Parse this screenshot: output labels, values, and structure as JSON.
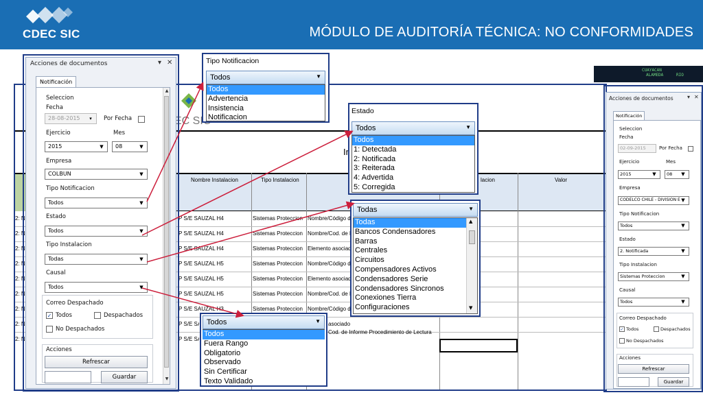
{
  "header": {
    "logo_text": "CDEC SIC",
    "title": "MÓDULO DE AUDITORÍA TÉCNICA: NO CONFORMIDADES"
  },
  "sheet": {
    "logo_fragment": "EC SIC",
    "title_fragment": "Inf",
    "col_headers": [
      "Nombre Instalacion",
      "Tipo Instalacion",
      "lacion",
      "Valor"
    ],
    "rows": [
      {
        "prefix": "2: N",
        "nombre": "P S/E SAUZAL H4",
        "tipo": "Sistemas Proteccion",
        "desc": "Nombre/Código de"
      },
      {
        "prefix": "2: N",
        "nombre": "P S/E SAUZAL H4",
        "tipo": "Sistemas Proteccion",
        "desc": "Nombre/Cod. de In"
      },
      {
        "prefix": "2: N",
        "nombre": "P S/E SAUZAL H4",
        "tipo": "Sistemas Proteccion",
        "desc": "Elemento asociado"
      },
      {
        "prefix": "2: N",
        "nombre": "P S/E SAUZAL H5",
        "tipo": "Sistemas Proteccion",
        "desc": "Nombre/Código de"
      },
      {
        "prefix": "2: N",
        "nombre": "P S/E SAUZAL H5",
        "tipo": "Sistemas Proteccion",
        "desc": "Elemento asociado"
      },
      {
        "prefix": "2: N",
        "nombre": "P S/E SAUZAL H5",
        "tipo": "Sistemas Proteccion",
        "desc": "Nombre/Cod. de In"
      },
      {
        "prefix": "2: N",
        "nombre": "P S/E SAUZAL H3",
        "tipo": "Sistemas Proteccion",
        "desc": "Nombre/Código de"
      },
      {
        "prefix": "2: N",
        "nombre": "P S/E SAUZAL H",
        "tipo": "",
        "desc": "asociado"
      },
      {
        "prefix": "2: N",
        "nombre": "P S/E SAUZAL H",
        "tipo": "",
        "desc": "Cod. de Informe Procedimiento de Lectura"
      }
    ]
  },
  "photo_strip": [
    "CUAYACAN",
    "ALAMEDA",
    "RIO"
  ],
  "panel_left": {
    "title": "Acciones de documentos",
    "tab": "Notificación",
    "seleccion": "Seleccion",
    "fecha_label": "Fecha",
    "fecha_value": "28-08-2015",
    "por_fecha": "Por Fecha",
    "ejercicio_label": "Ejercicio",
    "ejercicio_value": "2015",
    "mes_label": "Mes",
    "mes_value": "08",
    "empresa_label": "Empresa",
    "empresa_value": "COLBUN",
    "tipo_notif_label": "Tipo Notificacion",
    "tipo_notif_value": "Todos",
    "estado_label": "Estado",
    "estado_value": "Todos",
    "tipo_inst_label": "Tipo Instalacion",
    "tipo_inst_value": "Todas",
    "causal_label": "Causal",
    "causal_value": "Todos",
    "correo_label": "Correo Despachado",
    "todos": "Todos",
    "despachados": "Despachados",
    "no_despachados": "No Despachados",
    "acciones_label": "Acciones",
    "refrescar": "Refrescar",
    "guardar": "Guardar"
  },
  "panel_right": {
    "title": "Acciones de documentos",
    "tab": "Notificación",
    "seleccion": "Seleccion",
    "fecha_label": "Fecha",
    "fecha_value": "02-09-2015",
    "por_fecha": "Por Fecha",
    "ejercicio_label": "Ejercicio",
    "ejercicio_value": "2015",
    "mes_label": "Mes",
    "mes_value": "08",
    "empresa_label": "Empresa",
    "empresa_value": "CODELCO CHILE - DIVISION E",
    "tipo_notif_label": "Tipo Notificacion",
    "tipo_notif_value": "Todos",
    "estado_label": "Estado",
    "estado_value": "2. Notificada",
    "tipo_inst_label": "Tipo Instalacion",
    "tipo_inst_value": "Sistemas Proteccion",
    "causal_label": "Causal",
    "causal_value": "Todos",
    "correo_label": "Correo Despachado",
    "todos": "Todos",
    "despachados": "Despachados",
    "no_despachados": "No Despachados",
    "acciones_label": "Acciones",
    "refrescar": "Refrescar",
    "guardar": "Guardar"
  },
  "popup_tipo_notif": {
    "label": "Tipo Notificacion",
    "value": "Todos",
    "options": [
      "Todos",
      "Advertencia",
      "Insistencia",
      "Notificacion"
    ]
  },
  "popup_estado": {
    "label": "Estado",
    "value": "Todos",
    "options": [
      "Todos",
      "1: Detectada",
      "2: Notificada",
      "3: Reiterada",
      "4: Advertida",
      "5: Corregida"
    ]
  },
  "popup_tipo_inst": {
    "value": "Todas",
    "options": [
      "Todas",
      "Bancos Condensadores",
      "Barras",
      "Centrales",
      "Circuitos",
      "Compensadores Activos",
      "Condensadores Serie",
      "Condensadores Sincronos",
      "Conexiones Tierra",
      "Configuraciones"
    ]
  },
  "popup_causal": {
    "value": "Todos",
    "options": [
      "Todos",
      "Fuera Rango",
      "Obligatorio",
      "Observado",
      "Sin Certificar",
      "Texto Validado"
    ]
  },
  "colors": {
    "header_blue": "#1a6eb4",
    "outline_blue": "#1f3c88",
    "arrow_red": "#cc1f3c",
    "highlight": "#3399ff"
  }
}
